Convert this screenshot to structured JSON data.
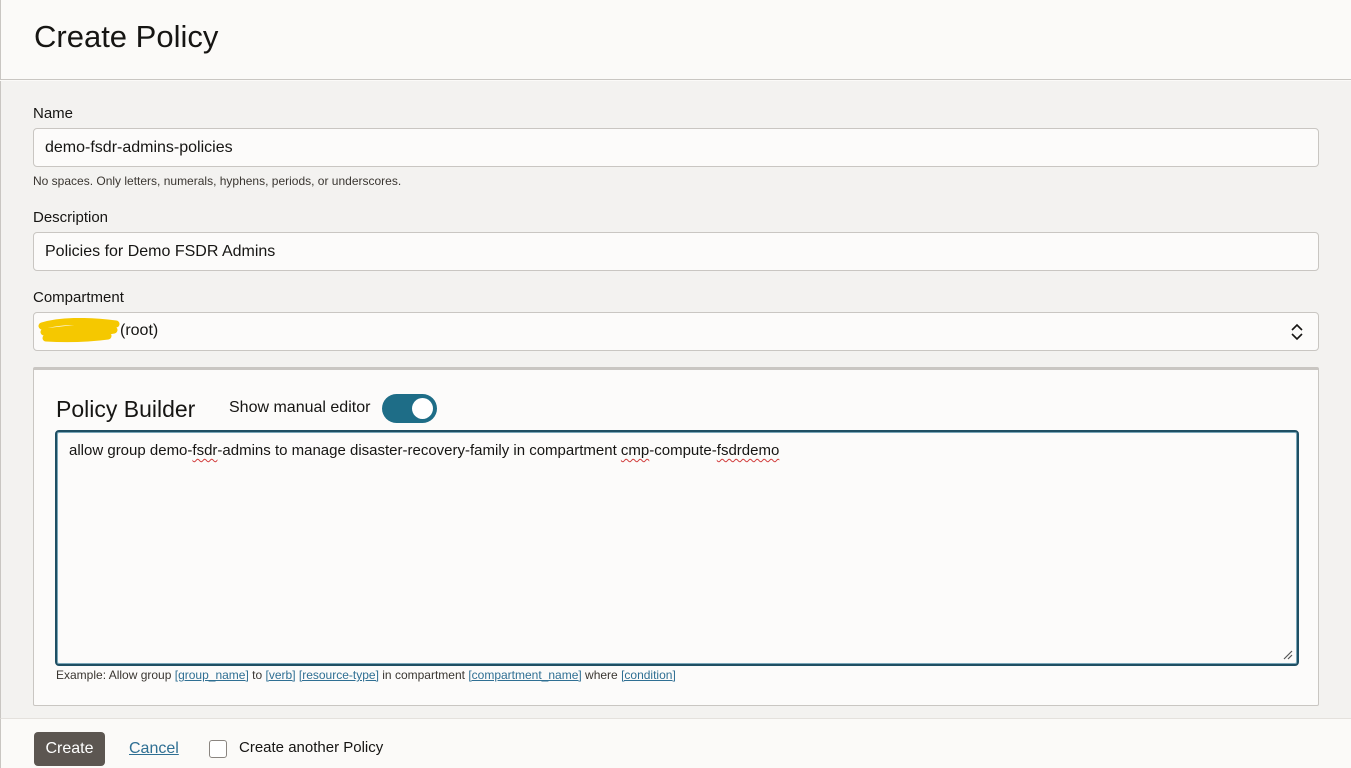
{
  "header": {
    "title": "Create Policy"
  },
  "form": {
    "name": {
      "label": "Name",
      "value": "demo-fsdr-admins-policies",
      "hint": "No spaces. Only letters, numerals, hyphens, periods, or underscores."
    },
    "description": {
      "label": "Description",
      "value": "Policies for Demo FSDR Admins"
    },
    "compartment": {
      "label": "Compartment",
      "selected_value": "(root)"
    }
  },
  "policy_builder": {
    "title": "Policy Builder",
    "toggle_label": "Show manual editor",
    "toggle_on": true,
    "statement_parts": {
      "p1": "allow group demo-",
      "p2": "fsdr",
      "p3": "-admins to manage disaster-recovery-family in compartment ",
      "p4": "cmp",
      "p5": "-compute-",
      "p6": "fsdrdemo"
    },
    "example": {
      "prefix": "Example: Allow group",
      "group_name": "[group_name]",
      "to": "to",
      "verb": "[verb]",
      "resource_type": "[resource-type]",
      "in_compartment": "in compartment",
      "compartment_name": "[compartment_name]",
      "where": "where",
      "condition": "[condition]"
    }
  },
  "footer": {
    "create_label": "Create",
    "cancel_label": "Cancel",
    "create_another_label": "Create another Policy",
    "create_another_checked": false
  },
  "colors": {
    "primary_button": "#5c5651",
    "toggle_on": "#1e6d87",
    "link": "#2f6f93",
    "redaction": "#f5c800"
  }
}
